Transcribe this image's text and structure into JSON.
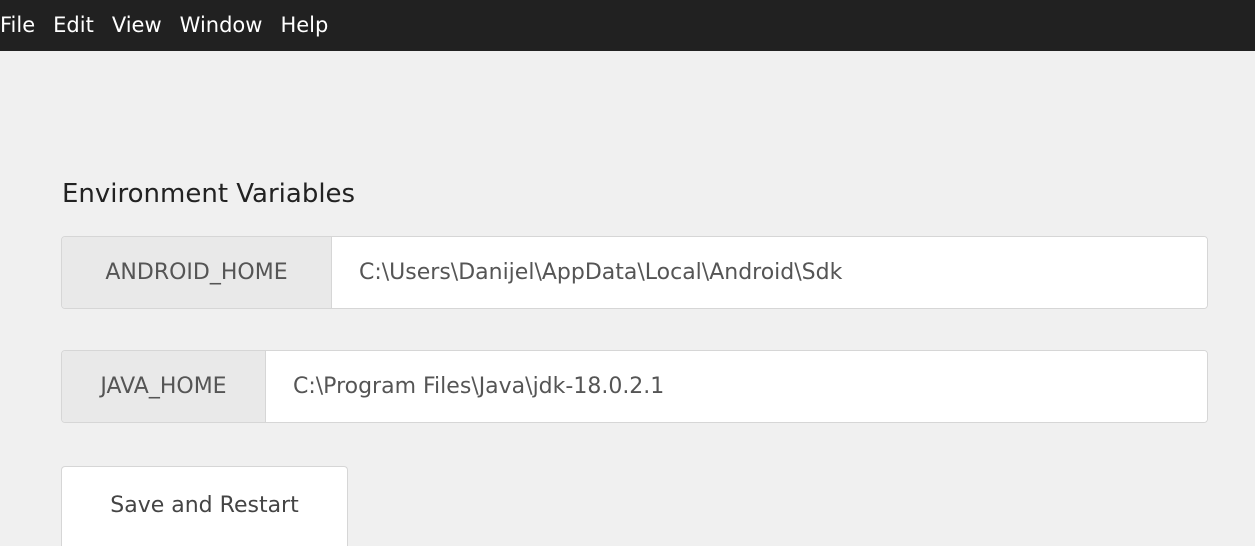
{
  "menubar": {
    "items": [
      {
        "label": "File"
      },
      {
        "label": "Edit"
      },
      {
        "label": "View"
      },
      {
        "label": "Window"
      },
      {
        "label": "Help"
      }
    ]
  },
  "section": {
    "title": "Environment Variables"
  },
  "env_vars": {
    "android_home": {
      "label": "ANDROID_HOME",
      "value": "C:\\Users\\Danijel\\AppData\\Local\\Android\\Sdk"
    },
    "java_home": {
      "label": "JAVA_HOME",
      "value": "C:\\Program Files\\Java\\jdk-18.0.2.1"
    }
  },
  "actions": {
    "save_label": "Save and Restart"
  },
  "colors": {
    "menubar_bg": "#212121",
    "page_bg": "#f0f0f0",
    "label_bg": "#e9e9e9"
  }
}
